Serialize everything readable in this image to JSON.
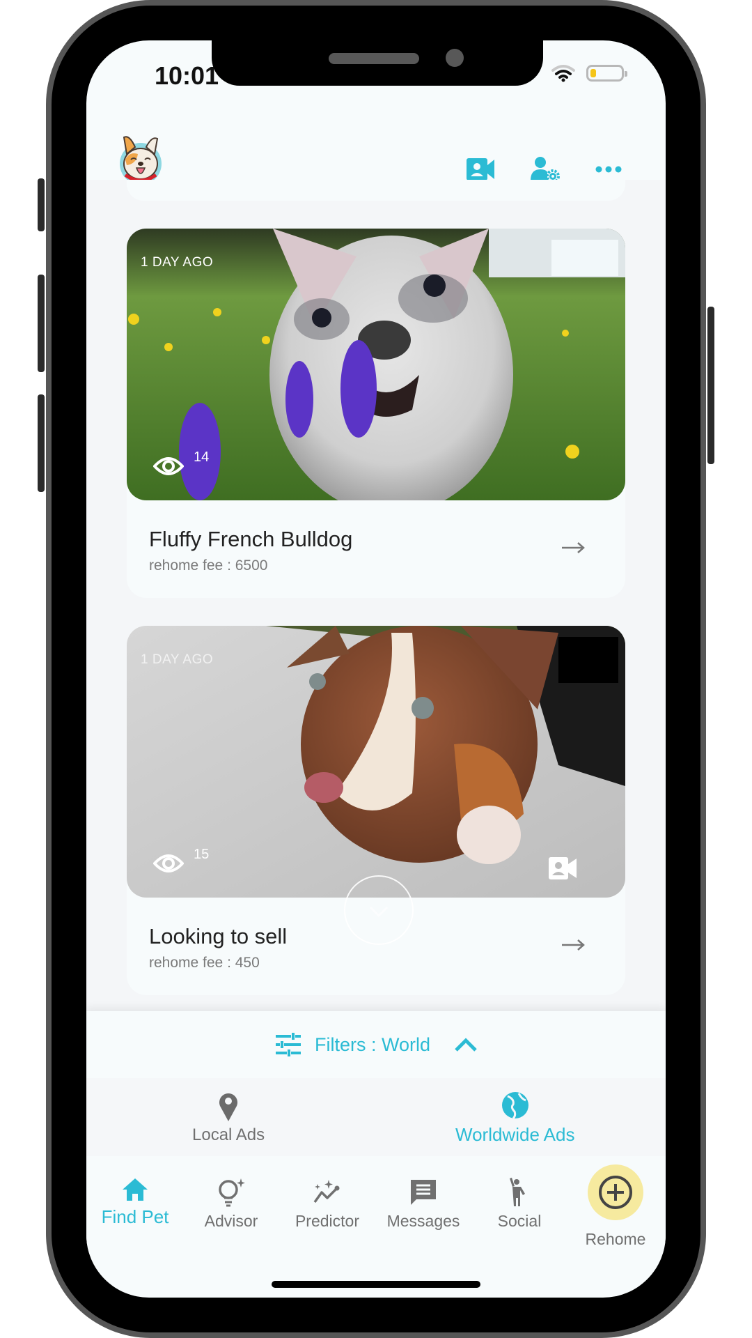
{
  "status_bar": {
    "time": "10:01",
    "battery_level": 0.1,
    "battery_color": "#f5c518"
  },
  "header": {
    "logo": "french-bulldog-logo",
    "actions": [
      {
        "icon": "video-contact-icon",
        "label": "Video"
      },
      {
        "icon": "user-settings-icon",
        "label": "Account settings"
      },
      {
        "icon": "more-icon",
        "label": "More"
      }
    ]
  },
  "feed": {
    "listings": [
      {
        "posted": "1 DAY AGO",
        "views": "14",
        "title": "Fluffy French Bulldog",
        "fee": "rehome fee : 6500",
        "has_video": false,
        "image": "merle french bulldog puppy in grass with purple flowers"
      },
      {
        "posted": "1 DAY AGO",
        "views": "15",
        "title": "Looking to sell",
        "fee": "rehome fee : 450",
        "has_video": true,
        "image": "brown and white puppy lying on grey blanket"
      }
    ]
  },
  "filters": {
    "label": "Filters : World"
  },
  "ad_scope": {
    "options": [
      {
        "label": "Local Ads",
        "icon": "location-pin-icon",
        "selected": false
      },
      {
        "label": "Worldwide Ads",
        "icon": "globe-icon",
        "selected": true
      }
    ]
  },
  "tabbar": {
    "tabs": [
      {
        "label": "Find Pet",
        "icon": "home-icon",
        "active": true
      },
      {
        "label": "Advisor",
        "icon": "lightbulb-icon",
        "active": false
      },
      {
        "label": "Predictor",
        "icon": "sparkle-chart-icon",
        "active": false
      },
      {
        "label": "Messages",
        "icon": "message-icon",
        "active": false
      },
      {
        "label": "Social",
        "icon": "person-waving-icon",
        "active": false
      },
      {
        "label": "Rehome",
        "icon": "add-circle-icon",
        "active": false
      }
    ]
  },
  "colors": {
    "accent": "#2bbbd4",
    "inactive": "#707070",
    "rehome_highlight": "#f6ea9f",
    "background": "#f7fbfc"
  }
}
